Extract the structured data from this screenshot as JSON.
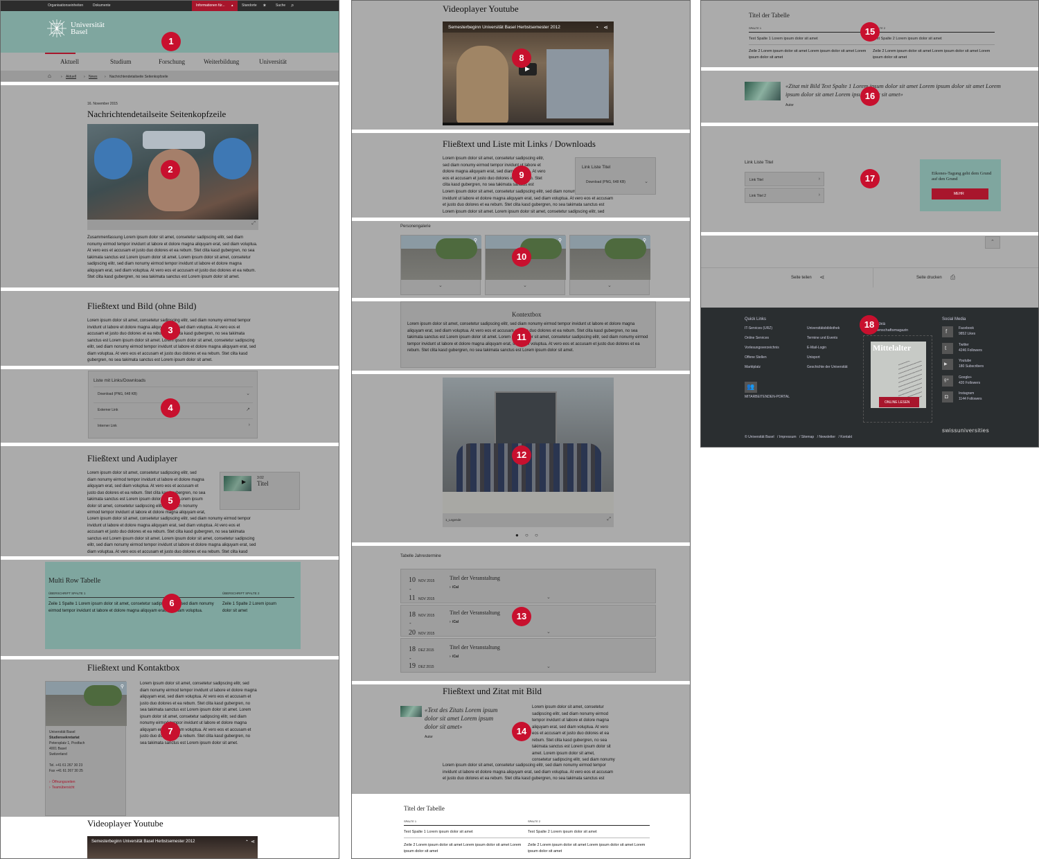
{
  "markers": [
    "1",
    "2",
    "3",
    "4",
    "5",
    "6",
    "7",
    "8",
    "9",
    "10",
    "11",
    "12",
    "13",
    "14",
    "15",
    "16",
    "17",
    "18"
  ],
  "topbar": {
    "links": [
      "Organisationseinheiten",
      "Dokumente"
    ],
    "info": "Informationen für...",
    "standorte": "Standorte",
    "suche": "Suche"
  },
  "brand": {
    "line1": "Universität",
    "line2": "Basel"
  },
  "nav": [
    "Aktuell",
    "Studium",
    "Forschung",
    "Weiterbildung",
    "Universität"
  ],
  "breadcrumb": [
    "Aktuell",
    "News",
    "Nachrichtendetailseite Seitenkopfzeile"
  ],
  "article": {
    "date": "16. November 2015",
    "title": "Nachrichtendetailseite Seitenkopfzeile",
    "summary": "Zusammenfassung Lorem ipsum dolor sit amet, consetetur sadipscing elitr, sed diam nonumy eirmod tempor invidunt ut labore et dolore magna aliquyam erat, sed diam voluptua. At vero eos et accusam et justo duo dolores et ea rebum. Stet clita kasd gubergren, no sea takimata sanctus est Lorem ipsum dolor sit amet. Lorem ipsum dolor sit amet, consetetur sadipscing elitr, sed diam nonumy eirmod tempor invidunt ut labore et dolore magna aliquyam erat, sed diam voluptua. At vero eos et accusam et justo duo dolores et ea rebum. Stet clita kasd gubergren, no sea takimata sanctus est Lorem ipsum dolor sit amet."
  },
  "lorem": "Lorem ipsum dolor sit amet, consetetur sadipscing elitr, sed diam nonumy eirmod tempor invidunt ut labore et dolore magna aliquyam erat, sed diam voluptua. At vero eos et accusam et justo duo dolores et ea rebum. Stet clita kasd gubergren, no sea takimata sanctus est Lorem ipsum dolor sit amet. Lorem ipsum dolor sit amet, consetetur sadipscing elitr, sed diam nonumy eirmod tempor invidunt ut labore et dolore magna aliquyam erat, sed diam voluptua. At vero eos et accusam et justo duo dolores et ea rebum. Stet clita kasd gubergren, no sea takimata sanctus est Lorem ipsum dolor sit amet.",
  "textimage": {
    "title": "Fließtext und Bild (ohne Bild)"
  },
  "linklist": {
    "title": "Liste mit Links/Downloads",
    "items": [
      "Download (PNG, 648 KB)",
      "Externer Link",
      "Interner Link"
    ]
  },
  "audio": {
    "title": "Fließtext und Audiplayer",
    "duration": "3:02",
    "label": "Titel"
  },
  "multirow": {
    "title": "Multi Row Tabelle",
    "col1": "ÜBERSCHRIFT SPALTE 1",
    "col2": "ÜBERSCHRIFT SPALTE 2",
    "cell1": "Zeile 1 Spalte 1 Lorem ipsum dolor sit amet, consetetur sadipscing elitr, sed diam nonumy eirmod tempor invidunt ut labore et dolore magna aliquyam erat, sed diam voluptua.",
    "cell2": "Zeile 1 Spalte 2 Lorem ipsum dolor sit amet"
  },
  "contact": {
    "title": "Fließtext und Kontaktbox",
    "name": "Universität Basel",
    "dept": "Studiensekretariat",
    "street": "Petersplatz 1, Postfach",
    "city": "4001 Basel",
    "country": "Switzerland",
    "tel": "Tel. +41 61 267 30 23",
    "fax": "Fax +41 61 267 30 25",
    "link1": "Öffnungszeiten",
    "link2": "Teamübersicht"
  },
  "video": {
    "title": "Videoplayer Youtube",
    "caption": "Semesterbeginn Universität Basel Herbstsemester 2012"
  },
  "textlinks": {
    "title": "Fließtext und Liste mit Links / Downloads",
    "boxtitle": "Link Liste Titel",
    "download": "Download (PNG, 648 KB)"
  },
  "gallery": {
    "title": "Personengalerie"
  },
  "kontextbox": {
    "title": "Kontextbox"
  },
  "slider": {
    "legend": "1_Legende"
  },
  "events": {
    "title": "Tabelle Jahrestermine",
    "items": [
      {
        "d1": "10",
        "m1": "NOV 2015",
        "d2": "11",
        "m2": "NOV 2015",
        "name": "Titel der Veranstaltung",
        "ical": "iCal"
      },
      {
        "d1": "18",
        "m1": "NOV 2015",
        "d2": "20",
        "m2": "NOV 2015",
        "name": "Titel der Veranstaltung",
        "ical": "iCal"
      },
      {
        "d1": "18",
        "m1": "DEZ 2015",
        "d2": "19",
        "m2": "DEZ 2015",
        "name": "Titel der Veranstaltung",
        "ical": "iCal"
      }
    ]
  },
  "quote": {
    "title": "Fließtext und Zitat mit Bild",
    "text": "«Text des Zitats Lorem ipsum dolor sit amet Lorem ipsum dolor sit amet»",
    "author": "Autor"
  },
  "table": {
    "title": "Titel der Tabelle",
    "h1": "SPALTE 1",
    "h2": "SPALTE 2",
    "r1c1": "Text Spalte 1 Lorem ipsum dolor sit amet",
    "r1c2": "Text Spalte 2 Lorem ipsum dolor sit amet",
    "r2c1": "Zeile 2 Lorem ipsum dolor sit amet Lorem ipsum dolor sit amet Lorem ipsum dolor sit amet",
    "r2c2": "Zeile 2 Lorem ipsum dolor sit amet Lorem ipsum dolor sit amet Lorem ipsum dolor sit amet"
  },
  "quote2": {
    "text": "«Zitat mit Bild Text Spalte 1 Lorem ipsum dolor sit amet Lorem ipsum dolor sit amet Lorem ipsum dolor sit amet Lorem ipsum dolor sit amet»",
    "author": "Autor"
  },
  "linklist2": {
    "title": "Link Liste Titel",
    "items": [
      "Link Titel",
      "Link Titel 2"
    ],
    "teaser": "Eikones-Tagung geht dem Grund auf den Grund",
    "button": "MEHR"
  },
  "share": {
    "share": "Seite teilen",
    "print": "Seite drucken"
  },
  "footer": {
    "quicklinks_title": "Quick Links",
    "links_left": [
      "IT-Services (URZ)",
      "Online Services",
      "Vorlesungsverzeichnis",
      "Offene Stellen",
      "Marktplatz"
    ],
    "links_right": [
      "Universitätsbibliothek",
      "Termine und Events",
      "E-Mail-Login",
      "Unisport",
      "Geschichte der Universität"
    ],
    "portal": "MITARBEITENDEN-PORTAL",
    "uninova_title": "UniNova",
    "uninova_sub": "Wissenschaftsmagazin",
    "mag_title": "Mittelalter",
    "read": "ONLINE LESEN",
    "social_title": "Social Media",
    "social": [
      {
        "icon": "f",
        "name": "Facebook",
        "count": "9852 Likes"
      },
      {
        "icon": "t",
        "name": "Twitter",
        "count": "4246 Followers"
      },
      {
        "icon": "yt",
        "name": "Youtube",
        "count": "180 Subscribers"
      },
      {
        "icon": "g+",
        "name": "Google+",
        "count": "420 Followers"
      },
      {
        "icon": "ig",
        "name": "Instagram",
        "count": "1144 Followers"
      }
    ],
    "bottom": [
      "© Universität Basel",
      "Impressum",
      "Sitemap",
      "Newsletter",
      "Kontakt"
    ],
    "swiss": "swissuniversities"
  }
}
